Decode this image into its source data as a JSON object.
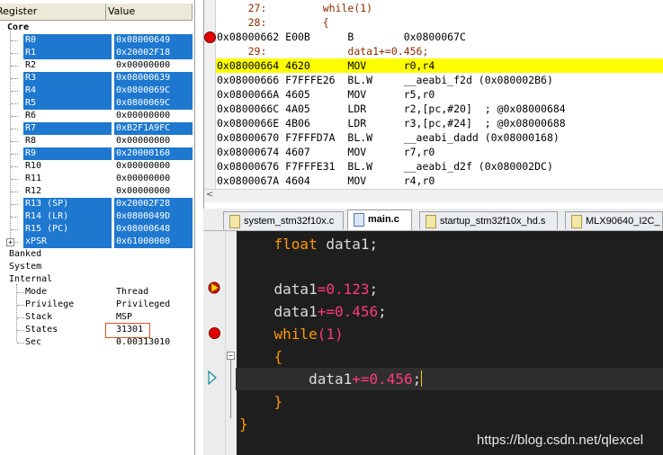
{
  "registers": {
    "header": {
      "col_register": "Register",
      "col_value": "Value"
    },
    "core_label": "Core",
    "rows": [
      {
        "name": "R0",
        "value": "0x08000649",
        "selected": true
      },
      {
        "name": "R1",
        "value": "0x20002F18",
        "selected": true
      },
      {
        "name": "R2",
        "value": "0x00000000",
        "selected": false
      },
      {
        "name": "R3",
        "value": "0x08000639",
        "selected": true
      },
      {
        "name": "R4",
        "value": "0x0800069C",
        "selected": true
      },
      {
        "name": "R5",
        "value": "0x0800069C",
        "selected": true
      },
      {
        "name": "R6",
        "value": "0x00000000",
        "selected": false
      },
      {
        "name": "R7",
        "value": "0xB2F1A9FC",
        "selected": true
      },
      {
        "name": "R8",
        "value": "0x00000000",
        "selected": false
      },
      {
        "name": "R9",
        "value": "0x20000160",
        "selected": true
      },
      {
        "name": "R10",
        "value": "0x00000000",
        "selected": false
      },
      {
        "name": "R11",
        "value": "0x00000000",
        "selected": false
      },
      {
        "name": "R12",
        "value": "0x00000000",
        "selected": false
      },
      {
        "name": "R13 (SP)",
        "value": "0x20002F28",
        "selected": true
      },
      {
        "name": "R14 (LR)",
        "value": "0x0800049D",
        "selected": true
      },
      {
        "name": "R15 (PC)",
        "value": "0x08000648",
        "selected": true
      },
      {
        "name": "xPSR",
        "value": "0x61000000",
        "selected": true
      }
    ],
    "banked_label": "Banked",
    "system_label": "System",
    "internal_label": "Internal",
    "internal_rows": [
      {
        "name": "Mode",
        "value": "Thread"
      },
      {
        "name": "Privilege",
        "value": "Privileged"
      },
      {
        "name": "Stack",
        "value": "MSP"
      },
      {
        "name": "States",
        "value": "31301"
      },
      {
        "name": "Sec",
        "value": "0.00313010"
      }
    ]
  },
  "disassembly": {
    "lines": [
      {
        "text": "     27:         while(1)",
        "kind": "src"
      },
      {
        "text": "     28:         {",
        "kind": "src"
      },
      {
        "text": "0x08000662 E00B      B        0x0800067C",
        "kind": "asm"
      },
      {
        "text": "     29:             data1+=0.456;",
        "kind": "src"
      },
      {
        "text": "0x08000664 4620      MOV      r0,r4",
        "kind": "asm"
      },
      {
        "text": "0x08000666 F7FFFE26  BL.W     __aeabi_f2d (0x080002B6)",
        "kind": "asm"
      },
      {
        "text": "0x0800066A 4605      MOV      r5,r0",
        "kind": "asm"
      },
      {
        "text": "0x0800066C 4A05      LDR      r2,[pc,#20]  ; @0x08000684",
        "kind": "asm"
      },
      {
        "text": "0x0800066E 4B06      LDR      r3,[pc,#24]  ; @0x08000688",
        "kind": "asm"
      },
      {
        "text": "0x08000670 F7FFFD7A  BL.W     __aeabi_dadd (0x08000168)",
        "kind": "asm"
      },
      {
        "text": "0x08000674 4607      MOV      r7,r0",
        "kind": "asm"
      },
      {
        "text": "0x08000676 F7FFFE31  BL.W     __aeabi_d2f (0x080002DC)",
        "kind": "asm"
      },
      {
        "text": "0x0800067A 4604      MOV      r4,r0",
        "kind": "asm"
      }
    ],
    "scroll_left": "<"
  },
  "tabs": [
    {
      "label": "system_stm32f10x.c",
      "active": false
    },
    {
      "label": "main.c",
      "active": true
    },
    {
      "label": "startup_stm32f10x_hd.s",
      "active": false
    },
    {
      "label": "MLX90640_I2C_",
      "active": false
    }
  ],
  "editor": {
    "watermark": "https://blog.csdn.net/qlexcel"
  },
  "colors": {
    "selection": "#1e78d0",
    "current_line": "#ffff00",
    "breakpoint": "#e00000",
    "keyword": "#ff9900",
    "operator": "#ff3a7a"
  }
}
